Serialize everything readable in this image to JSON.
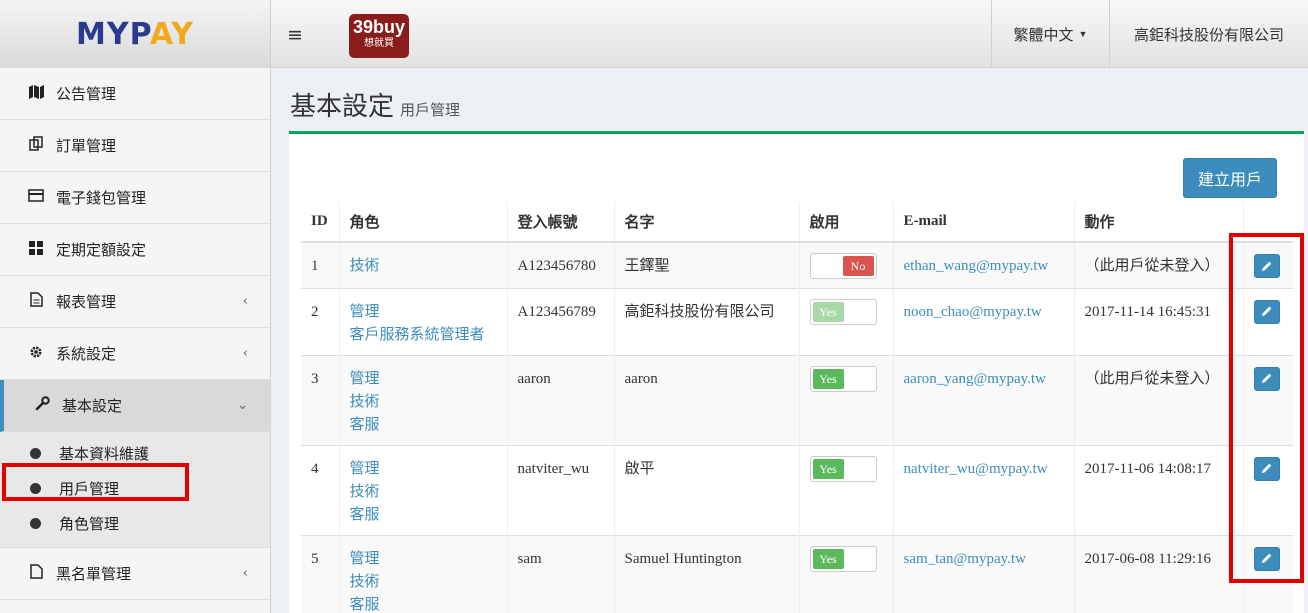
{
  "logo": {
    "text_main": "MYP",
    "text_accent": "AY"
  },
  "topbar": {
    "menu_icon": "≡",
    "brand_title": "39buy",
    "brand_subtitle": "想就買",
    "language": "繁體中文",
    "company": "高鉅科技股份有限公司"
  },
  "sidebar": {
    "items": [
      {
        "label": "公告管理",
        "icon": "map-icon"
      },
      {
        "label": "訂單管理",
        "icon": "copy-icon"
      },
      {
        "label": "電子錢包管理",
        "icon": "credit-card-icon"
      },
      {
        "label": "定期定額設定",
        "icon": "grid-icon"
      },
      {
        "label": "報表管理",
        "icon": "file-icon",
        "chevron": "‹"
      },
      {
        "label": "系統設定",
        "icon": "gear-icon",
        "chevron": "‹"
      },
      {
        "label": "基本設定",
        "icon": "wrench-icon",
        "chevron": "⌄"
      }
    ],
    "submenu": [
      {
        "label": "基本資料維護"
      },
      {
        "label": "用戶管理"
      },
      {
        "label": "角色管理"
      }
    ],
    "last_item": {
      "label": "黑名單管理",
      "icon": "file-icon",
      "chevron": "‹"
    }
  },
  "page": {
    "title": "基本設定",
    "subtitle": "用戶管理",
    "create_button": "建立用戶"
  },
  "table": {
    "headers": [
      "ID",
      "角色",
      "登入帳號",
      "名字",
      "啟用",
      "E-mail",
      "動作",
      ""
    ],
    "rows": [
      {
        "id": "1",
        "roles": [
          "技術"
        ],
        "account": "A123456780",
        "name": "王鐸聖",
        "enabled": "No",
        "email": "ethan_wang@mypay.tw",
        "action": "（此用戶從未登入）"
      },
      {
        "id": "2",
        "roles": [
          "管理",
          "客戶服務系統管理者"
        ],
        "account": "A123456789",
        "name": "高鉅科技股份有限公司",
        "enabled": "Yes",
        "email": "noon_chao@mypay.tw",
        "action": "2017-11-14 16:45:31"
      },
      {
        "id": "3",
        "roles": [
          "管理",
          "技術",
          "客服"
        ],
        "account": "aaron",
        "name": "aaron",
        "enabled": "Yes",
        "email": "aaron_yang@mypay.tw",
        "action": "（此用戶從未登入）"
      },
      {
        "id": "4",
        "roles": [
          "管理",
          "技術",
          "客服"
        ],
        "account": "natviter_wu",
        "name": "啟平",
        "enabled": "Yes",
        "email": "natviter_wu@mypay.tw",
        "action": "2017-11-06 14:08:17"
      },
      {
        "id": "5",
        "roles": [
          "管理",
          "技術",
          "客服"
        ],
        "account": "sam",
        "name": "Samuel Huntington",
        "enabled": "Yes",
        "email": "sam_tan@mypay.tw",
        "action": "2017-06-08 11:29:16"
      }
    ]
  },
  "colors": {
    "accent": "#3c8dbc",
    "box_top": "#00a65a",
    "toggle_no": "#d9534f",
    "toggle_yes": "#5cb85c",
    "highlight": "#e50000"
  }
}
